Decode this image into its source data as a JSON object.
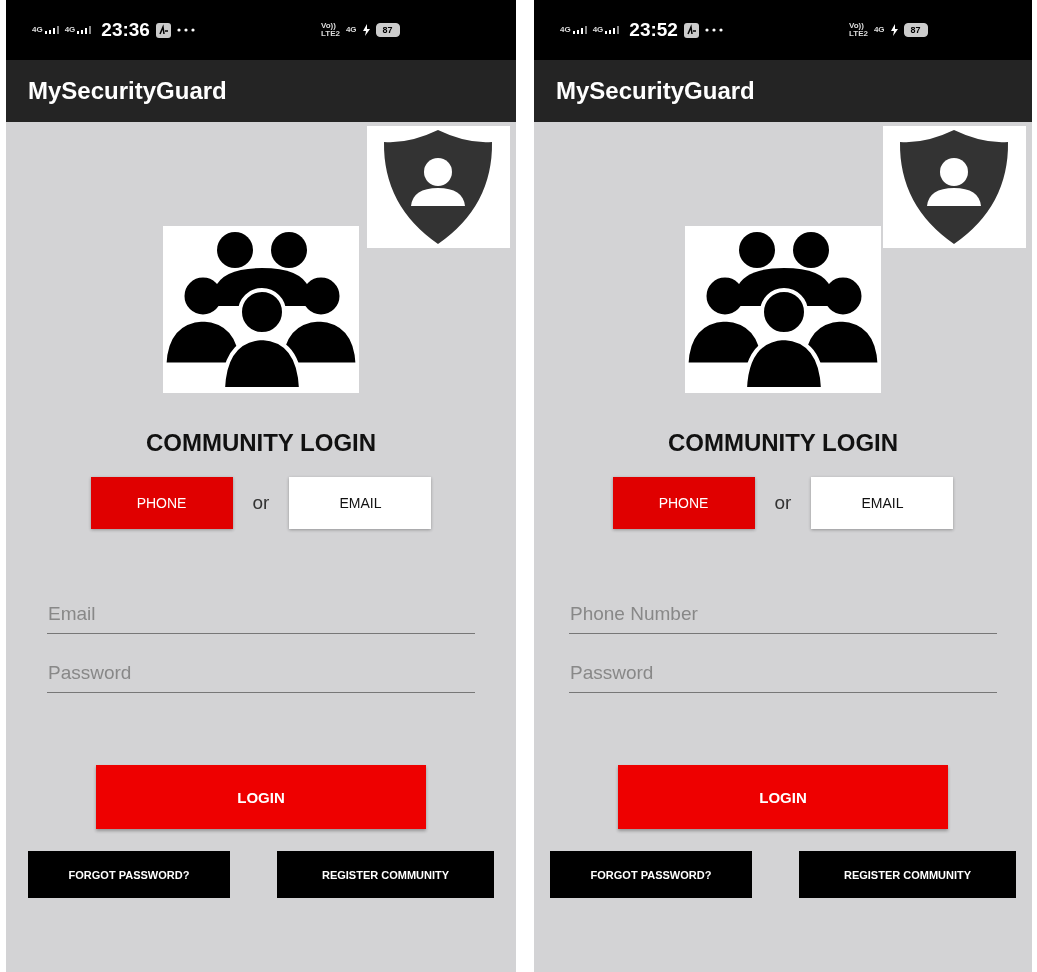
{
  "screens": [
    {
      "status_bar": {
        "left_labels": [
          "4G",
          "4G"
        ],
        "time": "23:36",
        "right_labels": [
          "Vo))\nLTE2",
          "4G"
        ],
        "battery": "87"
      },
      "app_title": "MySecurityGuard",
      "heading": "COMMUNITY LOGIN",
      "login_modes": [
        {
          "label": "PHONE",
          "selected": true
        },
        {
          "label": "EMAIL",
          "selected": false
        }
      ],
      "separator": "or",
      "fields": [
        {
          "placeholder": "Email"
        },
        {
          "placeholder": "Password"
        }
      ],
      "login_button": "LOGIN",
      "buttons": [
        "FORGOT PASSWORD?",
        "REGISTER COMMUNITY"
      ]
    },
    {
      "status_bar": {
        "left_labels": [
          "4G",
          "4G"
        ],
        "time": "23:52",
        "right_labels": [
          "Vo))\nLTE2",
          "4G"
        ],
        "battery": "87"
      },
      "app_title": "MySecurityGuard",
      "heading": "COMMUNITY LOGIN",
      "login_modes": [
        {
          "label": "PHONE",
          "selected": true
        },
        {
          "label": "EMAIL",
          "selected": false
        }
      ],
      "separator": "or",
      "fields": [
        {
          "placeholder": "Phone Number"
        },
        {
          "placeholder": "Password"
        }
      ],
      "login_button": "LOGIN",
      "buttons": [
        "FORGOT PASSWORD?",
        "REGISTER COMMUNITY"
      ]
    }
  ]
}
